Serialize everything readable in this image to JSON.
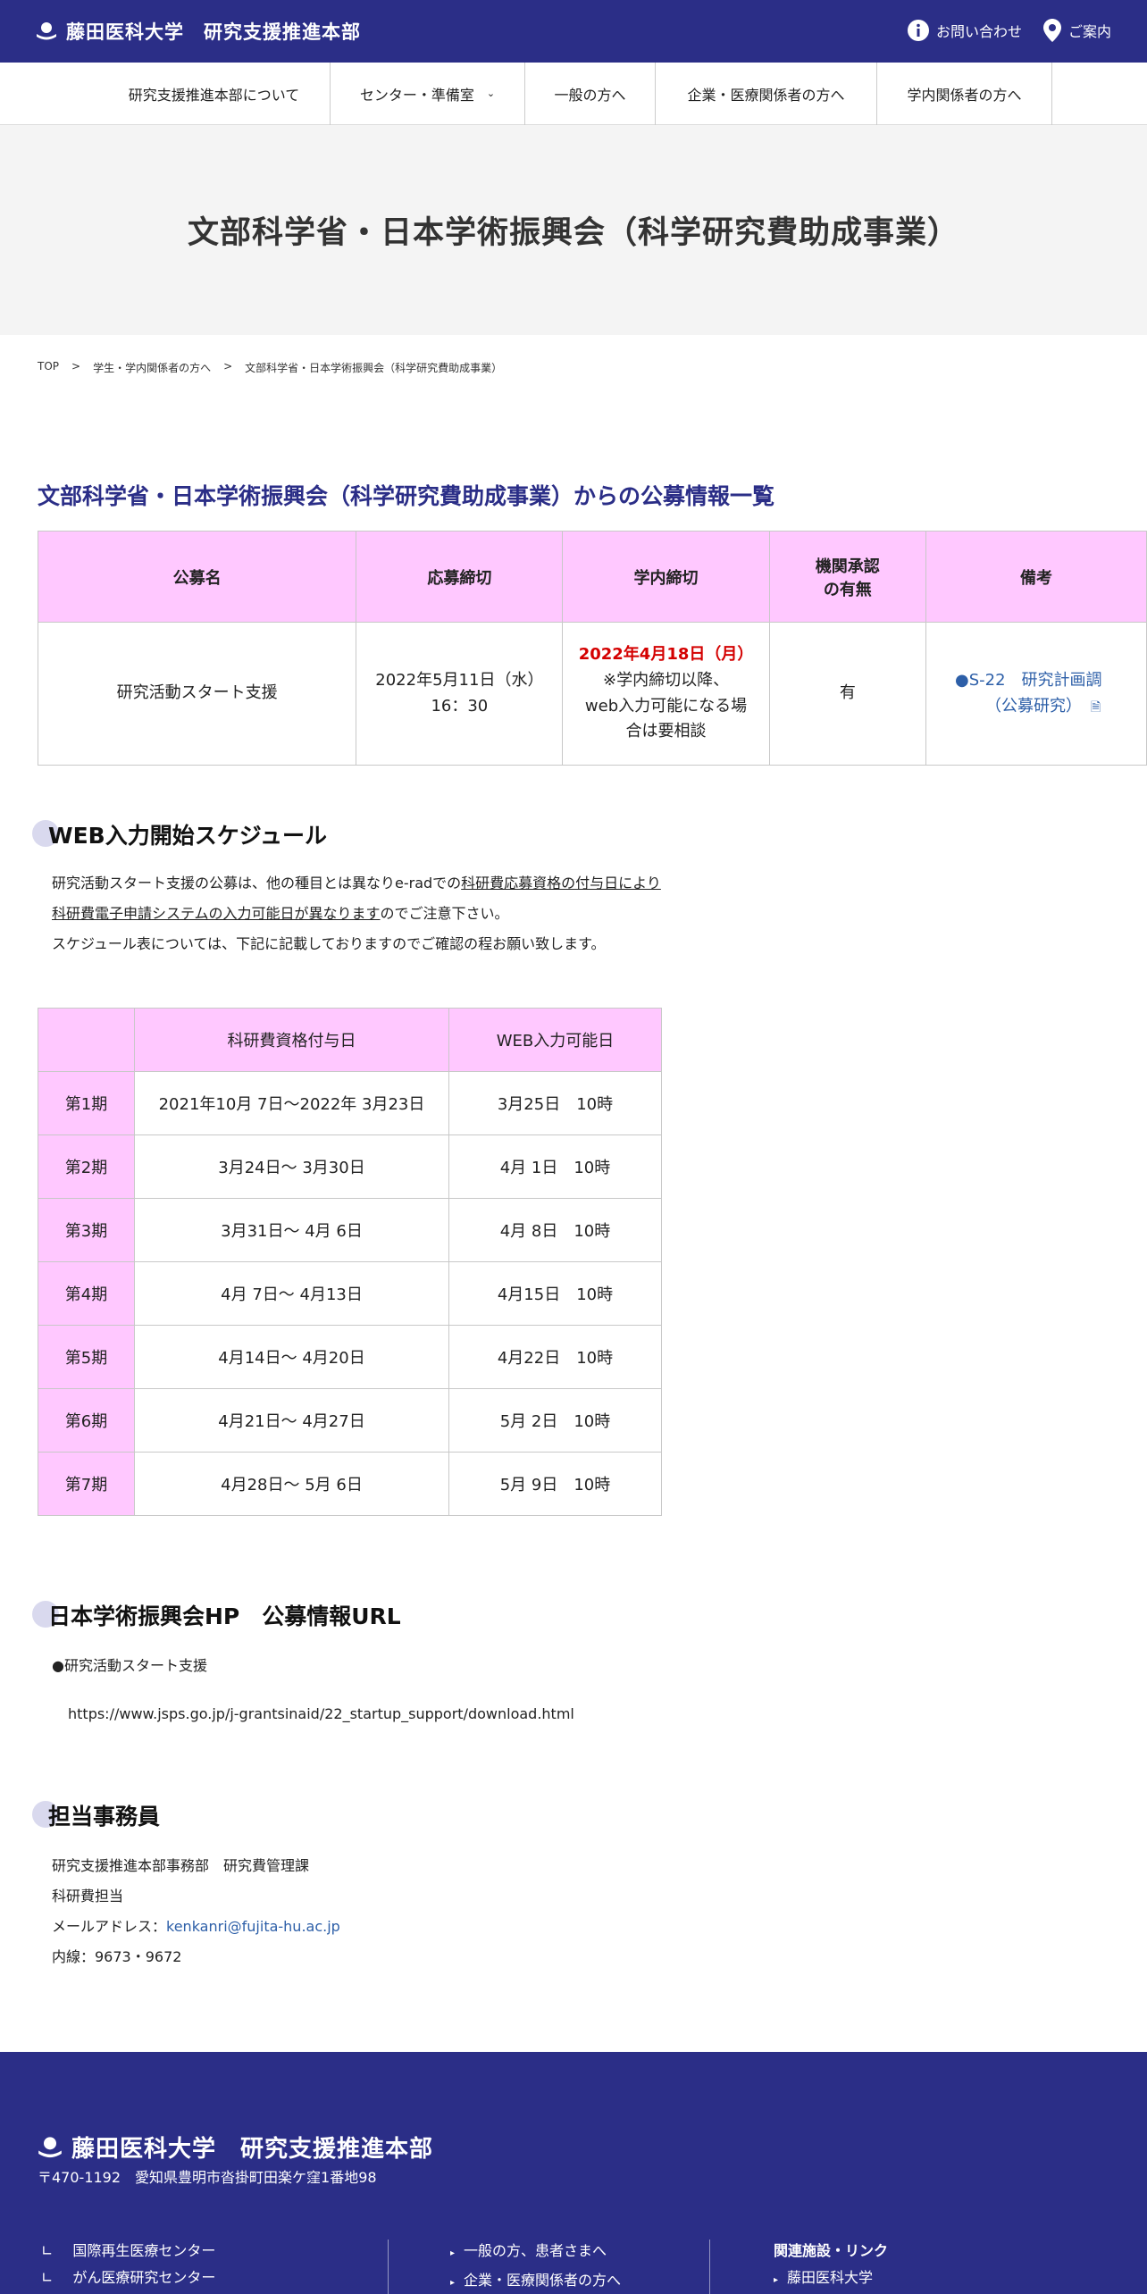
{
  "header": {
    "logo_text": "藤田医科大学　研究支援推進本部",
    "contact": "お問い合わせ",
    "guide": "ご案内"
  },
  "nav": {
    "items": [
      "研究支援推進本部について",
      "センター・準備室",
      "一般の方へ",
      "企業・医療関係者の方へ",
      "学内関係者の方へ"
    ]
  },
  "hero": {
    "title": "文部科学省・日本学術振興会（科学研究費助成事業）"
  },
  "breadcrumb": [
    "TOP",
    "学生・学内関係者の方へ",
    "文部科学省・日本学術振興会（科学研究費助成事業）"
  ],
  "section_title": "文部科学省・日本学術振興会（科学研究費助成事業）からの公募情報一覧",
  "table1": {
    "headers": [
      "公募名",
      "応募締切",
      "学内締切",
      "機関承認\nの有無",
      "備考"
    ],
    "row": {
      "name": "研究活動スタート支援",
      "deadline_1": "2022年5月11日（水）",
      "deadline_2": "16：30",
      "internal_deadline": "2022年4月18日（月）",
      "internal_note_1": "※学内締切以降、",
      "internal_note_2": "web入力可能になる場",
      "internal_note_3": "合は要相談",
      "approval": "有",
      "note_1": "●S-22　研究計画調",
      "note_2": "（公募研究）"
    }
  },
  "schedule": {
    "heading": "WEB入力開始スケジュール",
    "p1_a": "研究活動スタート支援の公募は、他の種目とは異なりe-radでの",
    "p1_b": "科研費応募資格の付与日により",
    "p2_a": "科研費電子申請システムの入力可能日が異なります",
    "p2_b": "のでご注意下さい。",
    "p3": "スケジュール表については、下記に記載しておりますのでご確認の程お願い致します。",
    "headers": [
      "",
      "科研費資格付与日",
      "WEB入力可能日"
    ],
    "rows": [
      {
        "phase": "第1期",
        "grant": "2021年10月 7日～2022年 3月23日",
        "web": "3月25日　10時"
      },
      {
        "phase": "第2期",
        "grant": "3月24日～ 3月30日",
        "web": "4月 1日　10時"
      },
      {
        "phase": "第3期",
        "grant": "3月31日～ 4月 6日",
        "web": "4月 8日　10時"
      },
      {
        "phase": "第4期",
        "grant": "4月 7日～ 4月13日",
        "web": "4月15日　10時"
      },
      {
        "phase": "第5期",
        "grant": "4月14日～ 4月20日",
        "web": "4月22日　10時"
      },
      {
        "phase": "第6期",
        "grant": "4月21日～ 4月27日",
        "web": "5月 2日　10時"
      },
      {
        "phase": "第7期",
        "grant": "4月28日～ 5月 6日",
        "web": "5月 9日　10時"
      }
    ]
  },
  "jsps": {
    "heading": "日本学術振興会HP　公募情報URL",
    "item": "●研究活動スタート支援",
    "url": "https://www.jsps.go.jp/j-grantsinaid/22_startup_support/download.html"
  },
  "contact_office": {
    "heading": "担当事務員",
    "line1": "研究支援推進本部事務部　研究費管理課",
    "line2": "科研費担当",
    "mail_label": "メールアドレス：",
    "mail": "kenkanri@fujita-hu.ac.jp",
    "ext": "内線：9673・9672"
  },
  "footer": {
    "logo_text": "藤田医科大学　研究支援推進本部",
    "address": "〒470-1192　愛知県豊明市沓掛町田楽ケ窪1番地98",
    "col1": [
      "国際再生医療センター",
      "がん医療研究センター"
    ],
    "col2": [
      "一般の方、患者さまへ",
      "企業・医療関係者の方へ"
    ],
    "col3_title": "関連施設・リンク",
    "col3": [
      "藤田医科大学"
    ]
  },
  "colors": {
    "brand": "#2b2e87",
    "table_header": "#ffc8ff",
    "deadline_red": "#d40000",
    "link": "#2d5fa8"
  }
}
